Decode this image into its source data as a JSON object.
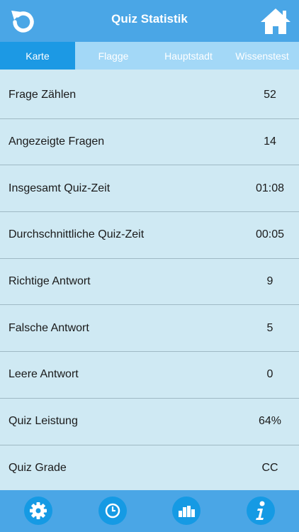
{
  "header": {
    "title": "Quiz Statistik",
    "back_icon": "undo-arrow-icon",
    "home_icon": "home-icon"
  },
  "tabs": [
    {
      "label": "Karte",
      "active": true
    },
    {
      "label": "Flagge",
      "active": false
    },
    {
      "label": "Hauptstadt",
      "active": false
    },
    {
      "label": "Wissenstest",
      "active": false
    }
  ],
  "stats": [
    {
      "label": "Frage Zählen",
      "value": "52"
    },
    {
      "label": "Angezeigte Fragen",
      "value": "14"
    },
    {
      "label": "Insgesamt Quiz-Zeit",
      "value": "01:08"
    },
    {
      "label": "Durchschnittliche Quiz-Zeit",
      "value": "00:05"
    },
    {
      "label": "Richtige Antwort",
      "value": "9"
    },
    {
      "label": "Falsche Antwort",
      "value": "5"
    },
    {
      "label": "Leere Antwort",
      "value": "0"
    },
    {
      "label": "Quiz Leistung",
      "value": "64%"
    },
    {
      "label": "Quiz Grade",
      "value": "CC"
    }
  ],
  "footer": {
    "icons": [
      "gear-icon",
      "clock-icon",
      "bar-chart-icon",
      "info-icon"
    ]
  },
  "colors": {
    "header": "#4aa6e6",
    "tab_active": "#1c99e4",
    "tab_inactive": "#a3d8f7",
    "list_bg": "#cfe9f3",
    "footer_button": "#159ae4"
  }
}
